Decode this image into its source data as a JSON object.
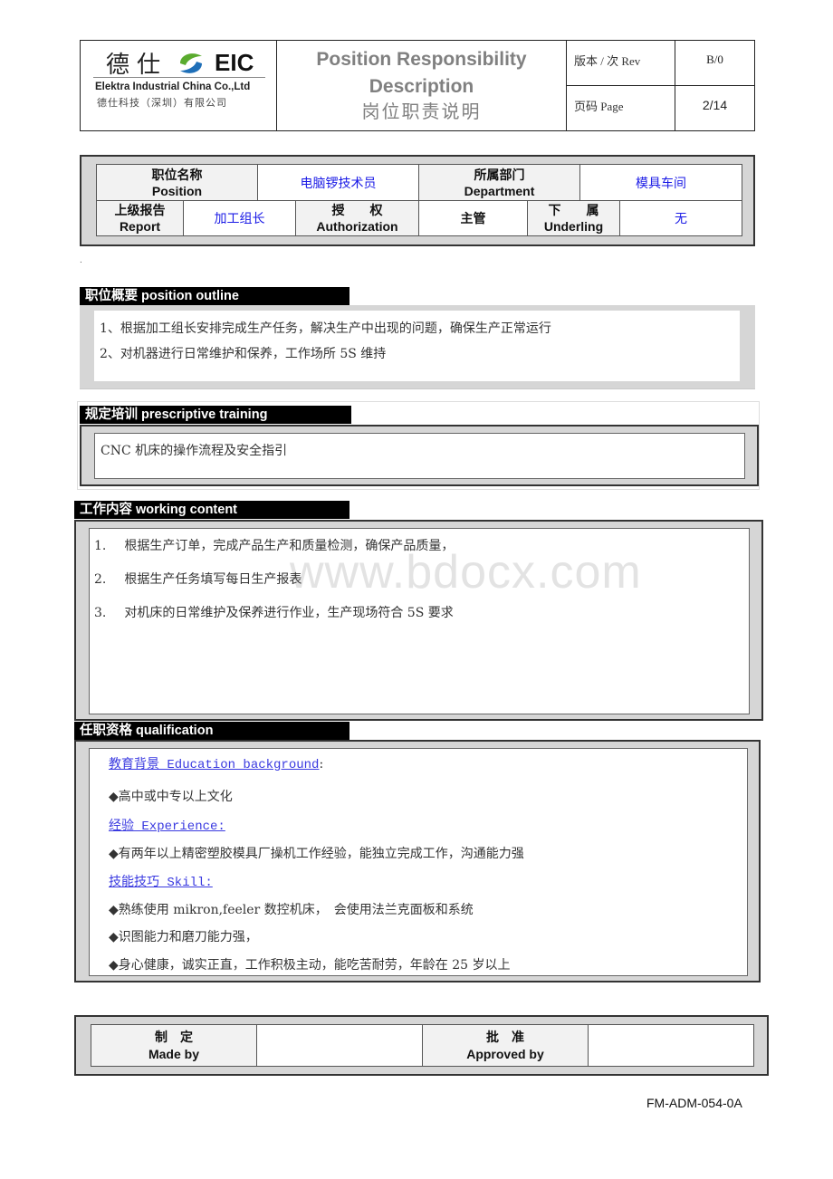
{
  "header": {
    "logo": {
      "cn_name": "德仕",
      "brand": "EIC",
      "company_en": "Elektra Industrial China Co.,Ltd",
      "company_cn": "德仕科技（深圳）有限公司",
      "mark_colors": {
        "green": "#5aab2e",
        "blue": "#1f6fb8"
      }
    },
    "title_en_line1": "Position Responsibility",
    "title_en_line2": "Description",
    "title_cn": "岗位职责说明",
    "rev_label": "版本 / 次 Rev",
    "rev_value": "B/0",
    "page_label": "页码 Page",
    "page_value": "2/14"
  },
  "position_info": {
    "position_label_cn": "职位名称",
    "position_label_en": "Position",
    "position_value": "电脑锣技术员",
    "department_label_cn": "所属部门",
    "department_label_en": "Department",
    "department_value": "模具车间",
    "report_label_cn": "上级报告",
    "report_label_en": "Report",
    "report_value": "加工组长",
    "authorization_label_cn": "授　　权",
    "authorization_label_en": "Authorization",
    "authorization_value": "主管",
    "underling_label_cn": "下　　属",
    "underling_label_en": "Underling",
    "underling_value": "无"
  },
  "stray_mark": ".",
  "sections": {
    "outline": {
      "title": "职位概要 position  outline",
      "items": [
        "1、根据加工组长安排完成生产任务，解决生产中出现的问题，确保生产正常运行",
        "2、对机器进行日常维护和保养，工作场所 5S 维持"
      ]
    },
    "training": {
      "title": "规定培训 prescriptive  training",
      "text": "CNC 机床的操作流程及安全指引"
    },
    "working": {
      "title": "工作内容 working content",
      "items": [
        {
          "num": "1.",
          "text": "根据生产订单，完成产品生产和质量检测，确保产品质量，"
        },
        {
          "num": "2.",
          "text": "根据生产任务填写每日生产报表"
        },
        {
          "num": "3.",
          "text": "对机床的日常维护及保养进行作业，生产现场符合 5S 要求"
        }
      ]
    },
    "qualification": {
      "title": "任职资格 qualification",
      "education_heading": "教育背景 Education background",
      "education_colon": ":",
      "education_items": [
        "◆高中或中专以上文化"
      ],
      "experience_heading": "经验 Experience:",
      "experience_items": [
        "◆有两年以上精密塑胶模具厂操机工作经验，能独立完成工作，沟通能力强"
      ],
      "skill_heading": "技能技巧 Skill:",
      "skill_items": [
        "◆熟练使用 mikron,feeler 数控机床，　会使用法兰克面板和系统",
        "◆识图能力和磨刀能力强，",
        "◆身心健康，诚实正直，工作积极主动，能吃苦耐劳，年龄在 25 岁以上"
      ]
    }
  },
  "watermark": "www.bdocx.com",
  "signature": {
    "made_by_cn": "制　定",
    "made_by_en": "Made by",
    "made_by_value": "",
    "approved_by_cn": "批　准",
    "approved_by_en": "Approved by",
    "approved_by_value": ""
  },
  "form_code": "FM-ADM-054-0A"
}
